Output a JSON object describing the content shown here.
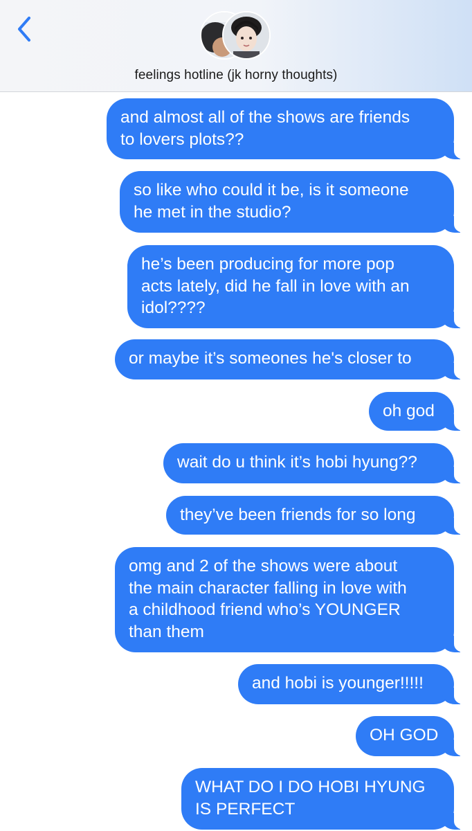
{
  "header": {
    "back_icon": "chevron-left-icon",
    "title": "feelings hotline (jk horny thoughts)",
    "accent_color": "#2f7cf6"
  },
  "messages": [
    {
      "text": "and almost all of the shows are friends\nto lovers plots??",
      "sender": "me"
    },
    {
      "text": "so like who could it be, is it someone\nhe met in the studio?",
      "sender": "me"
    },
    {
      "text": "he’s been producing for more pop\nacts lately, did he fall in love with an\nidol????",
      "sender": "me"
    },
    {
      "text": "or maybe it’s someones he's closer to",
      "sender": "me"
    },
    {
      "text": "oh god",
      "sender": "me"
    },
    {
      "text": "wait do u think it’s hobi hyung??",
      "sender": "me"
    },
    {
      "text": "they’ve been friends for so long",
      "sender": "me"
    },
    {
      "text": "omg and 2 of the shows were about\nthe main character falling in love with\na childhood friend who’s YOUNGER\nthan them",
      "sender": "me"
    },
    {
      "text": "and hobi is younger!!!!!",
      "sender": "me"
    },
    {
      "text": "OH GOD",
      "sender": "me"
    },
    {
      "text": "WHAT DO I DO HOBI HYUNG\nIS PERFECT",
      "sender": "me"
    }
  ]
}
